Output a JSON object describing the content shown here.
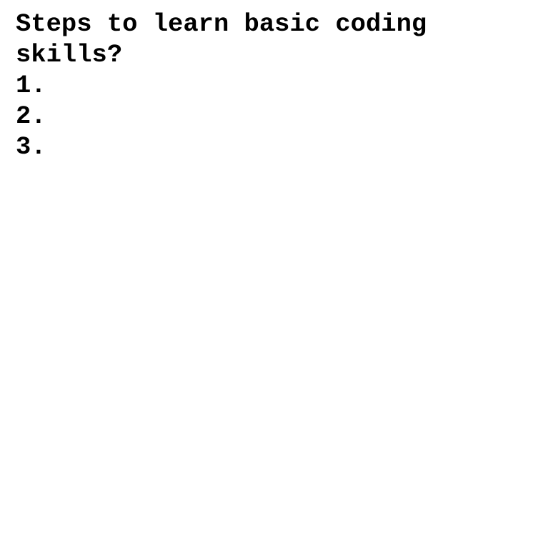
{
  "document": {
    "title_line1": "Steps to learn basic coding",
    "title_line2": "skills?",
    "steps": [
      {
        "label": "1."
      },
      {
        "label": "2."
      },
      {
        "label": "3."
      }
    ],
    "text_color": "#000000",
    "background_color": "#ffffff"
  }
}
